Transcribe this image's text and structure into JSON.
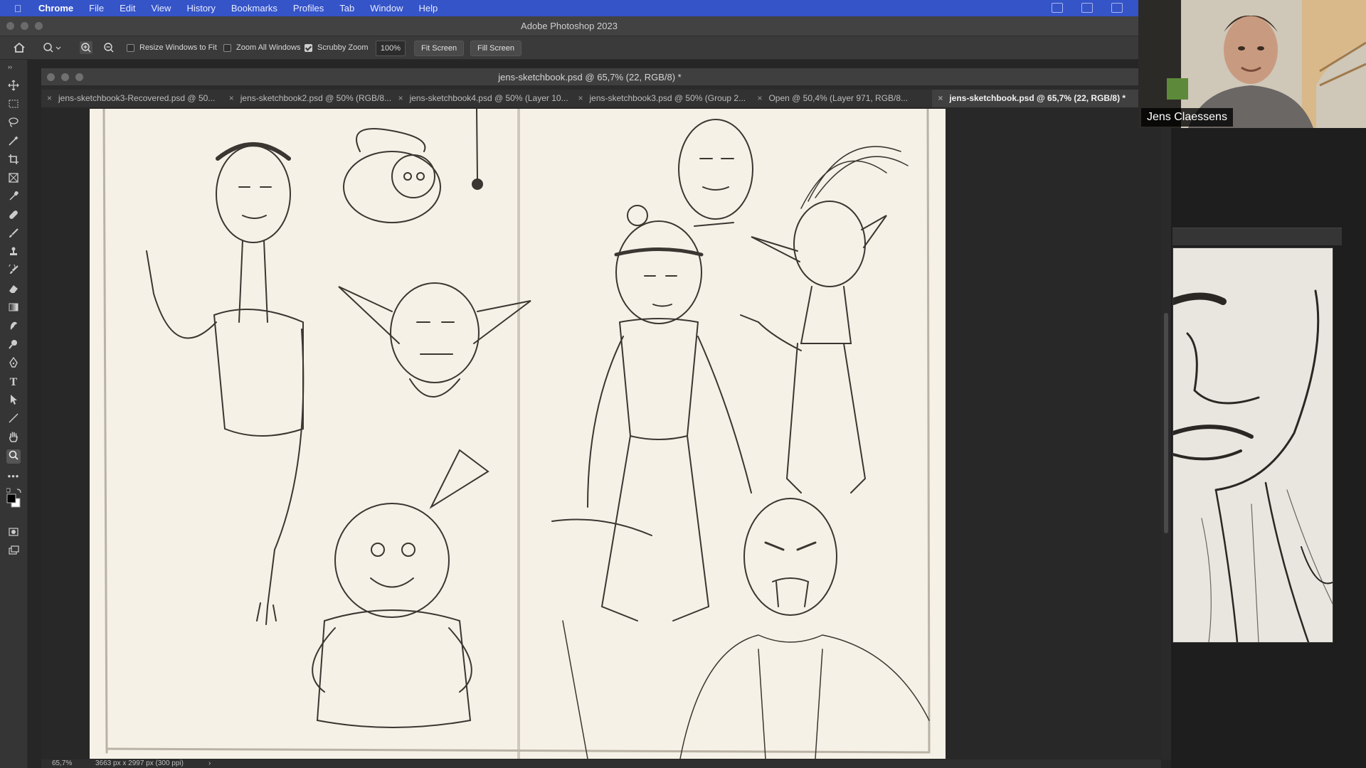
{
  "menubar": {
    "items": [
      "Chrome",
      "File",
      "Edit",
      "View",
      "History",
      "Bookmarks",
      "Profiles",
      "Tab",
      "Window",
      "Help"
    ]
  },
  "titlebar": {
    "title": "Adobe Photoshop 2023"
  },
  "options_bar": {
    "resize_windows": "Resize Windows to Fit",
    "zoom_all": "Zoom All Windows",
    "scrubby_zoom": "Scrubby Zoom",
    "scrubby_checked": true,
    "zoom_value": "100%",
    "fit_screen": "Fit Screen",
    "fill_screen": "Fill Screen"
  },
  "document": {
    "title": "jens-sketchbook.psd @ 65,7% (22, RGB/8) *",
    "tabs": [
      {
        "label": "jens-sketchbook3-Recovered.psd @ 50..."
      },
      {
        "label": "jens-sketchbook2.psd @ 50% (RGB/8..."
      },
      {
        "label": "jens-sketchbook4.psd @ 50% (Layer 10..."
      },
      {
        "label": "jens-sketchbook3.psd @ 50% (Group 2..."
      },
      {
        "label": "Open @ 50,4% (Layer 971, RGB/8..."
      },
      {
        "label": "jens-sketchbook.psd @ 65,7% (22, RGB/8) *"
      }
    ]
  },
  "statusbar": {
    "zoom": "65,7%",
    "info": "3663 px x 2997 px (300 ppi)"
  },
  "webcam": {
    "name": "Jens Claessens"
  },
  "colors": {
    "menubar": "#3554c8",
    "chrome": "#3a3a3a",
    "paper": "#f6f1e7"
  }
}
